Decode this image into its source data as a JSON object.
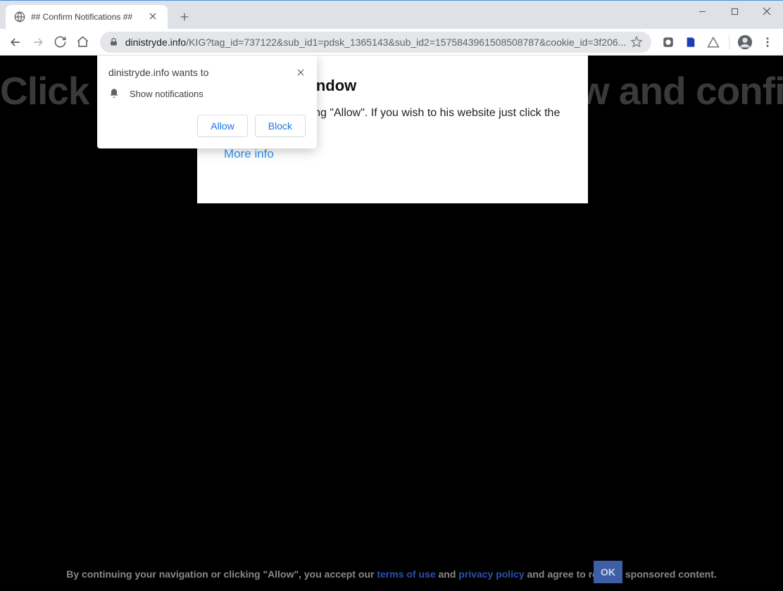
{
  "tab": {
    "title": "## Confirm Notifications ##"
  },
  "url": {
    "host": "dinistryde.info",
    "path": "/KIG?tag_id=737122&sub_id1=pdsk_1365143&sub_id2=1575843961508508787&cookie_id=3f206..."
  },
  "page": {
    "bigtext": "Click \"Allow\" to close this window and confirm you are not a",
    "modal": {
      "title": "close this window",
      "body": "e closed by pressing \"Allow\". If you wish to his website just click the more info button",
      "more": "More info"
    }
  },
  "permission": {
    "origin": "dinistryde.info wants to",
    "request": "Show notifications",
    "allow": "Allow",
    "block": "Block"
  },
  "footer": {
    "pre": "By continuing your navigation or clicking \"Allow\", you accept our ",
    "terms": "terms of use",
    "and": " and ",
    "privacy": "privacy policy",
    "post": " and agree to receive sponsored content.",
    "ok": "OK"
  }
}
